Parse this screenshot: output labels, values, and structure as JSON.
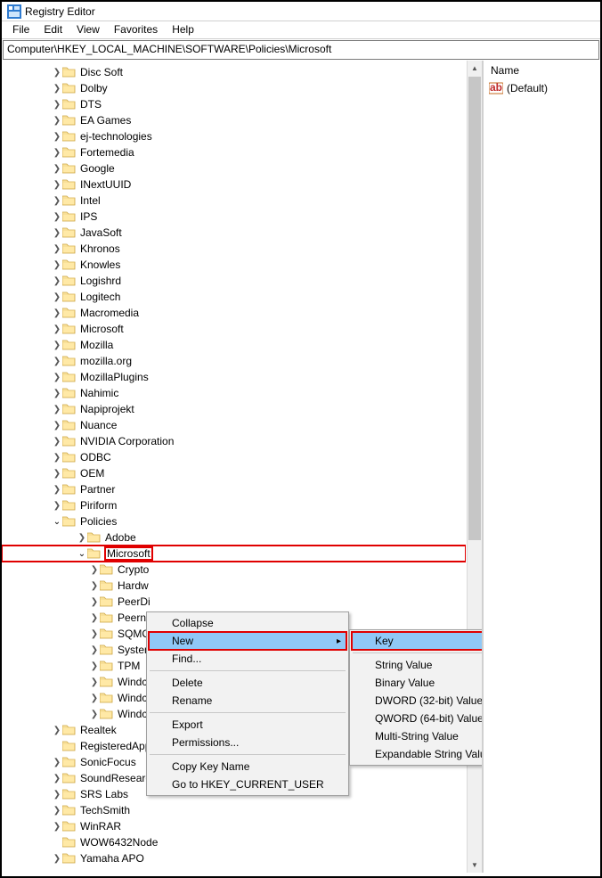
{
  "window": {
    "title": "Registry Editor"
  },
  "menu": {
    "items": [
      "File",
      "Edit",
      "View",
      "Favorites",
      "Help"
    ]
  },
  "addressbar": "Computer\\HKEY_LOCAL_MACHINE\\SOFTWARE\\Policies\\Microsoft",
  "valuepane": {
    "header": "Name",
    "default_label": "(Default)"
  },
  "tree": {
    "level0": [
      "Disc Soft",
      "Dolby",
      "DTS",
      "EA Games",
      "ej-technologies",
      "Fortemedia",
      "Google",
      "INextUUID",
      "Intel",
      "IPS",
      "JavaSoft",
      "Khronos",
      "Knowles",
      "Logishrd",
      "Logitech",
      "Macromedia",
      "Microsoft",
      "Mozilla",
      "mozilla.org",
      "MozillaPlugins",
      "Nahimic",
      "Napiprojekt",
      "Nuance",
      "NVIDIA Corporation",
      "ODBC",
      "OEM",
      "Partner",
      "Piriform"
    ],
    "policies": {
      "label": "Policies"
    },
    "level2": [
      "Adobe"
    ],
    "microsoft": {
      "label": "Microsoft"
    },
    "level3": [
      "Crypto",
      "Hardw",
      "PeerDi",
      "Peerne",
      "SQMC",
      "System",
      "TPM",
      "Windc",
      "Windc",
      "Windc"
    ],
    "level0_after": [
      "Realtek",
      "RegisteredApplications",
      "SonicFocus",
      "SoundResearch",
      "SRS Labs",
      "TechSmith",
      "WinRAR",
      "WOW6432Node",
      "Yamaha APO"
    ]
  },
  "context_menu": {
    "collapse": "Collapse",
    "new": "New",
    "find": "Find...",
    "delete": "Delete",
    "rename": "Rename",
    "export": "Export",
    "permissions": "Permissions...",
    "copy_key": "Copy Key Name",
    "goto_hkcu": "Go to HKEY_CURRENT_USER"
  },
  "submenu": {
    "key": "Key",
    "string": "String Value",
    "binary": "Binary Value",
    "dword32": "DWORD (32-bit) Value",
    "qword64": "QWORD (64-bit) Value",
    "multi": "Multi-String Value",
    "expand": "Expandable String Value"
  }
}
